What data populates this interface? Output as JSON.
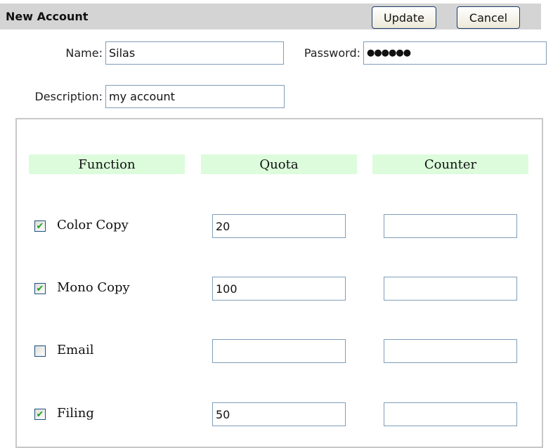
{
  "header": {
    "title": "New Account",
    "update_label": "Update",
    "cancel_label": "Cancel"
  },
  "form": {
    "name_label": "Name:",
    "name_value": "Silas",
    "password_label": "Password:",
    "password_value": "●●●●●●",
    "description_label": "Description:",
    "description_value": "my account"
  },
  "table": {
    "columns": [
      "Function",
      "Quota",
      "Counter"
    ],
    "rows": [
      {
        "function": "Color Copy",
        "checked": true,
        "quota": "20",
        "counter": ""
      },
      {
        "function": "Mono Copy",
        "checked": true,
        "quota": "100",
        "counter": ""
      },
      {
        "function": "Email",
        "checked": false,
        "quota": "",
        "counter": ""
      },
      {
        "function": "Filing",
        "checked": true,
        "quota": "50",
        "counter": ""
      }
    ]
  }
}
